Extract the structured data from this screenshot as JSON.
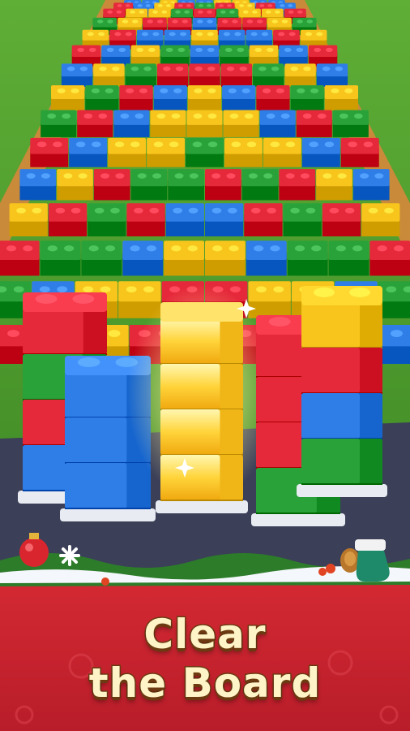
{
  "headline": {
    "line1": "Clear",
    "line2": "the Board"
  },
  "colors": {
    "red": "#e5283a",
    "blue": "#2f7ee8",
    "yellow": "#f7c51c",
    "green": "#2aa23a",
    "grass": "#4f9a2e",
    "banner": "#c8232f",
    "headline_fill": "#fff3c8",
    "headline_outline": "#6b3a10"
  },
  "decorations": [
    "ornament-icon",
    "snowflake-icon",
    "mitten-icon",
    "pinecone-icon",
    "holly-berry-icon"
  ]
}
